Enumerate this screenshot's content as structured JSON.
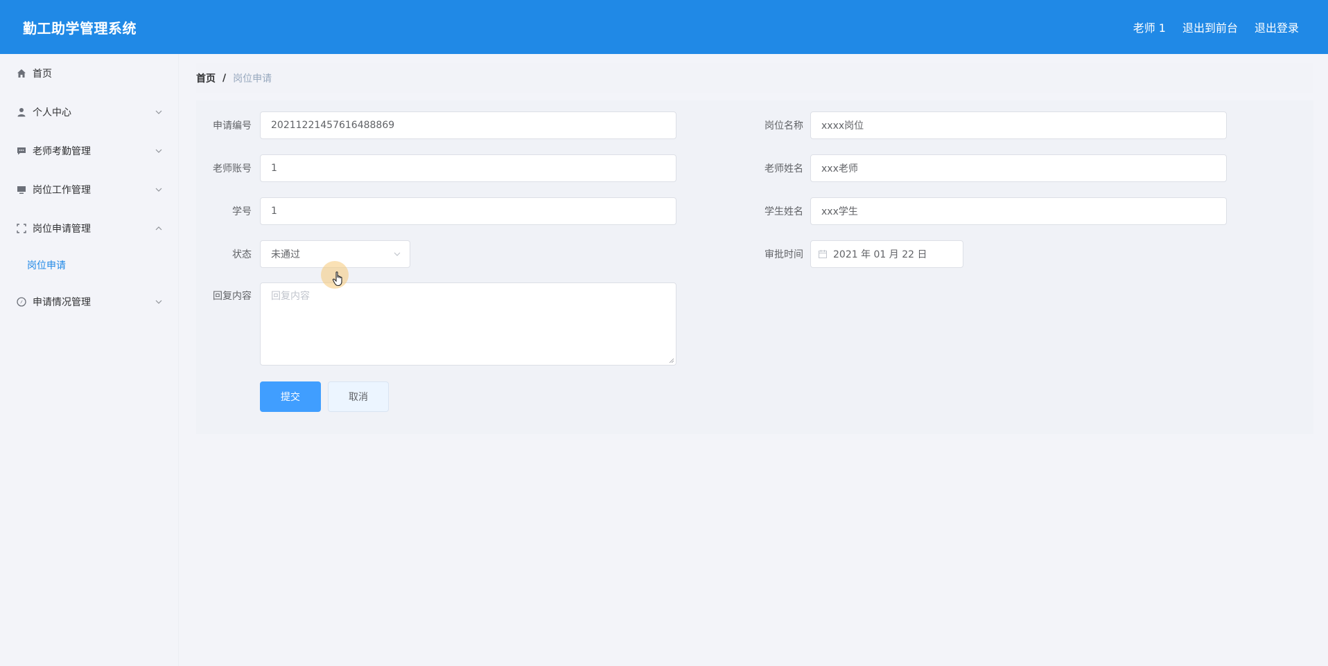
{
  "header": {
    "title": "勤工助学管理系统",
    "user": "老师 1",
    "exit_front": "退出到前台",
    "logout": "退出登录",
    "colors": {
      "bar": "#2089e6",
      "accent": "#409eff"
    }
  },
  "sidebar": {
    "items": [
      {
        "label": "首页",
        "icon": "home-icon"
      },
      {
        "label": "个人中心",
        "icon": "user-icon"
      },
      {
        "label": "老师考勤管理",
        "icon": "chat-icon"
      },
      {
        "label": "岗位工作管理",
        "icon": "monitor-icon"
      },
      {
        "label": "岗位申请管理",
        "icon": "fullscreen-icon",
        "expanded": true
      },
      {
        "label": "申请情况管理",
        "icon": "compass-icon"
      }
    ],
    "sub_items": [
      {
        "label": "岗位申请",
        "active": true
      }
    ]
  },
  "breadcrumb": {
    "home": "首页",
    "separator": "/",
    "current": "岗位申请"
  },
  "form": {
    "apply_no_label": "申请编号",
    "apply_no": "20211221457616488869",
    "post_name_label": "岗位名称",
    "post_name": "xxxx岗位",
    "teacher_account_label": "老师账号",
    "teacher_account": "1",
    "teacher_name_label": "老师姓名",
    "teacher_name": "xxx老师",
    "student_no_label": "学号",
    "student_no": "1",
    "student_name_label": "学生姓名",
    "student_name": "xxx学生",
    "status_label": "状态",
    "status": "未通过",
    "approve_time_label": "审批时间",
    "approve_time": "2021 年 01 月 22 日",
    "reply_label": "回复内容",
    "reply_placeholder": "回复内容",
    "submit": "提交",
    "cancel": "取消"
  }
}
